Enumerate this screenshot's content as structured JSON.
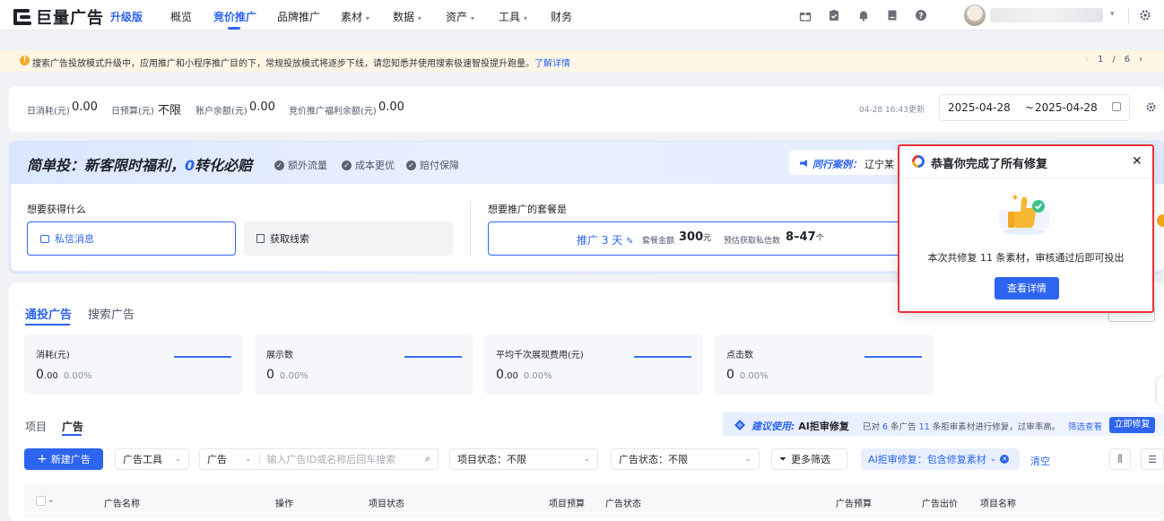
{
  "brand": {
    "name": "巨量广告",
    "edition": "升级版"
  },
  "nav": {
    "items": [
      "概览",
      "竞价推广",
      "品牌推广",
      "素材",
      "数据",
      "资产",
      "工具",
      "财务"
    ],
    "active": "竞价推广"
  },
  "top_icons": [
    "gift-icon",
    "clipboard-check-icon",
    "bell-icon",
    "document-icon",
    "help-icon",
    "settings-icon"
  ],
  "notice": {
    "text": "搜索广告投放模式升级中，应用推广和小程序推广目的下，常规投放模式将逐步下线，请您知悉并使用搜索极速智投提升跑量。",
    "link": "了解详情",
    "page": "1",
    "separator": "/",
    "total": "6"
  },
  "summary": {
    "items": [
      {
        "label": "日消耗(元)",
        "value": "0.00"
      },
      {
        "label": "日预算(元)",
        "value": "不限"
      },
      {
        "label": "账户余额(元)",
        "value": "0.00"
      },
      {
        "label": "竞价推广福利余额(元)",
        "value": "0.00"
      }
    ],
    "updated": "04-28 16:43更新",
    "date_start": "2025-04-28",
    "date_sep": "~",
    "date_end": "2025-04-28"
  },
  "promo": {
    "title_part1": "简单投：新客限时福利，",
    "title_zero": "0",
    "title_part2": "转化必赔",
    "tags": [
      "额外流量",
      "成本更优",
      "赔付保障"
    ],
    "peer_label": "同行案例：",
    "peer_value": "辽宁某",
    "q1": "想要获得什么",
    "choice_message": "私信消息",
    "choice_lead": "获取线索",
    "q2": "想要推广的套餐是",
    "pkg_days": "推广 3 天",
    "pkg_price_label": "套餐金额",
    "pkg_price": "300",
    "pkg_price_unit": "元",
    "pkg_est_label": "预估获取私信数",
    "pkg_est": "8–47",
    "pkg_est_unit": "个"
  },
  "main": {
    "subtabs": [
      "通投广告",
      "搜索广告"
    ],
    "metrics": [
      {
        "label": "消耗(元)",
        "value_int": "0",
        "value_dec": ".00",
        "pct": "0.00%"
      },
      {
        "label": "展示数",
        "value_int": "0",
        "value_dec": "",
        "pct": "0.00%"
      },
      {
        "label": "平均千次展现费用(元)",
        "value_int": "0",
        "value_dec": ".00",
        "pct": "0.00%"
      },
      {
        "label": "点击数",
        "value_int": "0",
        "value_dec": "",
        "pct": "0.00%"
      }
    ],
    "level_tabs": [
      "项目",
      "广告"
    ],
    "recommend": {
      "label": "建议使用:",
      "title": "AI拒审修复",
      "desc_1": "已对",
      "ads": "6",
      "desc_2": "条广告",
      "materials": "11",
      "desc_3": "条拒审素材进行修复，过审率高。",
      "filter": "筛选查看",
      "button": "立即修复"
    }
  },
  "toolbar": {
    "new_ad": "新建广告",
    "ad_tools": "广告工具",
    "search_type": "广告",
    "search_placeholder": "输入广告ID或名称后回车搜索",
    "project_status_label": "项目状态：",
    "project_status_value": "不限",
    "ad_status_label": "广告状态：",
    "ad_status_value": "不限",
    "more_filters": "更多筛选",
    "ai_filter": "AI拒审修复：包含修复素材",
    "clear": "清空"
  },
  "table": {
    "headers": [
      "广告名称",
      "操作",
      "项目状态",
      "项目预算",
      "广告状态",
      "广告预算",
      "广告出价",
      "项目名称"
    ]
  },
  "popup": {
    "title": "恭喜你完成了所有修复",
    "message": "本次共修复 11 条素材，审核通过后即可投出",
    "button": "查看详情"
  },
  "colors": {
    "primary": "#2d64f0",
    "highlight_border": "#e8343a",
    "notice_bg": "#fdf6e4"
  }
}
